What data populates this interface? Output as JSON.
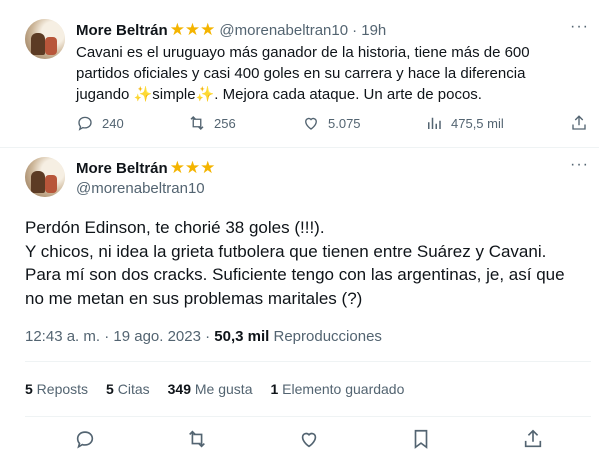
{
  "quoted": {
    "name": "More Beltrán",
    "stars": "★★★",
    "handle": "@morenabeltran10",
    "time": "· 19h",
    "more": "···",
    "text_before": "Cavani es el uruguayo más ganador de la historia, tiene más de 600 partidos oficiales y casi 400 goles en su carrera y hace la diferencia jugando ",
    "spark1": "✨",
    "text_mid": "simple",
    "spark2": "✨",
    "text_after": ". Mejora cada ataque. Un arte de pocos.",
    "replies": "240",
    "reposts": "256",
    "likes": "5.075",
    "views": "475,5 mil"
  },
  "main": {
    "name": "More Beltrán",
    "stars": "★★★",
    "handle": "@morenabeltran10",
    "more": "···",
    "line1": "Perdón Edinson, te chorié 38 goles (!!!).",
    "line2": "Y chicos, ni idea la grieta futbolera que tienen entre Suárez y Cavani.",
    "line3": "Para mí son dos cracks. Suficiente tengo con las argentinas, je, así que",
    "line4": "no me metan en sus problemas maritales (?)",
    "time": "12:43 a. m. · 19 ago. 2023 · ",
    "views_count": "50,3 mil",
    "views_label": " Reproducciones"
  },
  "stats": {
    "reposts_count": "5",
    "reposts_label": " Reposts",
    "quotes_count": "5",
    "quotes_label": " Citas",
    "likes_count": "349",
    "likes_label": " Me gusta",
    "bookmarks_count": "1",
    "bookmarks_label": " Elemento guardado"
  },
  "icons": [
    "reply-icon",
    "repost-icon",
    "like-icon",
    "views-icon",
    "share-icon",
    "bookmark-icon"
  ]
}
